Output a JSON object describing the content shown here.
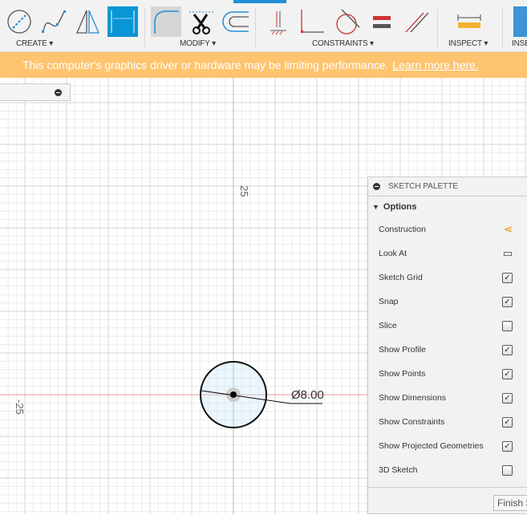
{
  "toolbar": {
    "groups": [
      {
        "label": "CREATE ▾"
      },
      {
        "label": "MODIFY ▾"
      },
      {
        "label": "CONSTRAINTS ▾"
      },
      {
        "label": "INSPECT ▾"
      },
      {
        "label": "INSE"
      }
    ],
    "tools": [
      "circle-icon",
      "spline-icon",
      "mirror-icon",
      "dimension-icon",
      "fillet-icon",
      "trim-icon",
      "offset-icon",
      "horizontal-vertical-constraint-icon",
      "coincident-constraint-icon",
      "tangent-constraint-icon",
      "equal-constraint-icon",
      "parallel-constraint-icon",
      "measure-icon",
      "insert-image-icon"
    ],
    "active_tool": "dimension-icon"
  },
  "banner": {
    "message": "This computer's graphics driver or hardware may be limiting performance.",
    "link": "Learn more here.",
    "color": "#fec46f"
  },
  "canvas": {
    "axis_labels": {
      "y": "25",
      "x": "-25"
    },
    "dimension": "Ø8.00"
  },
  "palette": {
    "title": "SKETCH PALETTE",
    "section": "Options",
    "rows": [
      {
        "label": "Construction",
        "icon": "construction-icon"
      },
      {
        "label": "Look At",
        "icon": "look-at-icon"
      },
      {
        "label": "Sketch Grid",
        "checked": true
      },
      {
        "label": "Snap",
        "checked": true
      },
      {
        "label": "Slice",
        "checked": false
      },
      {
        "label": "Show Profile",
        "checked": true
      },
      {
        "label": "Show Points",
        "checked": true
      },
      {
        "label": "Show Dimensions",
        "checked": true
      },
      {
        "label": "Show Constraints",
        "checked": true
      },
      {
        "label": "Show Projected Geometries",
        "checked": true
      },
      {
        "label": "3D Sketch",
        "checked": false
      }
    ],
    "finish": "Finish Sketch"
  }
}
